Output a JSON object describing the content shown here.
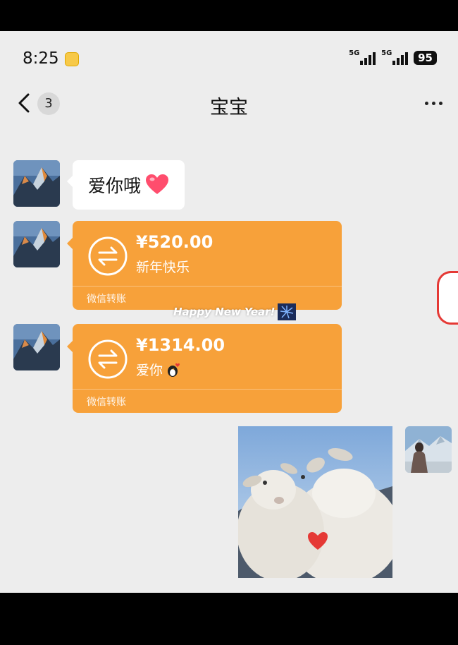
{
  "status_bar": {
    "time": "8:25",
    "battery": "95",
    "network_1": "5G",
    "network_2": "5G"
  },
  "header": {
    "back_badge": "3",
    "title": "宝宝",
    "more_icon": "more-dots-icon"
  },
  "messages": {
    "text": {
      "content": "爱你哦"
    },
    "transfer_1": {
      "amount": "¥520.00",
      "note": "新年快乐",
      "footer": "微信转账"
    },
    "transfer_2": {
      "amount": "¥1314.00",
      "note": "爱你",
      "footer": "微信转账"
    },
    "overlay": "Happy New Year!"
  },
  "colors": {
    "transfer_bg": "#f7a13a",
    "chat_bg": "#ededed",
    "bubble_bg": "#ffffff",
    "heart": "#ff4d6d"
  }
}
